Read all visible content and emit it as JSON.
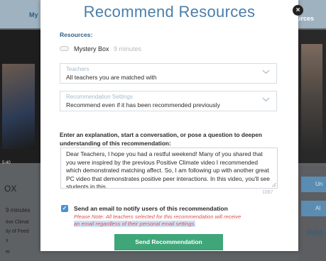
{
  "background": {
    "tab_left": "My",
    "tab_right": "urces",
    "video_time": "5:40",
    "title": "OX",
    "minutes": "9 minutes",
    "lines": [
      "tive Climat",
      "ity of Feed",
      "x",
      "er"
    ],
    "btn_right_1": "Un",
    "btn_right_2": "Al",
    "related": "Rela"
  },
  "modal": {
    "title": "Recommend Resources",
    "close_label": "×",
    "resources_label": "Resources:",
    "resource": {
      "name": "Mystery Box",
      "time": "9 minutes"
    },
    "teachers": {
      "label": "Teachers",
      "value": "All teachers you are matched with"
    },
    "settings": {
      "label": "Recommendation Settings",
      "value": "Recommend even if it has been recommended previously"
    },
    "explain_prompt": "Enter an explanation, start a conversation, or pose a question to deepen understanding of this recommendation:",
    "message": "Dear Teachers, I hope you had a restful weekend! Many of you shared that you were inspired by the previous Positive Climate video I recommended which demonstrated matching affect. So, I am following up with another great PC video that demonstrates positive peer interactions. In this video, you'll see students in this",
    "char_count": "1067",
    "email_label": "Send an email to notify users of this recommendation",
    "email_checked": true,
    "note_line1": "Please Note: All teachers selected for this recommendation will receive",
    "note_line2": "an email regardless of their personal email settings.",
    "send_button": "Send Recommendation"
  },
  "colors": {
    "title": "#4a7eaa",
    "accent_green": "#3fa679",
    "checkbox_blue": "#4a90d9",
    "note_red": "#d9534f"
  }
}
